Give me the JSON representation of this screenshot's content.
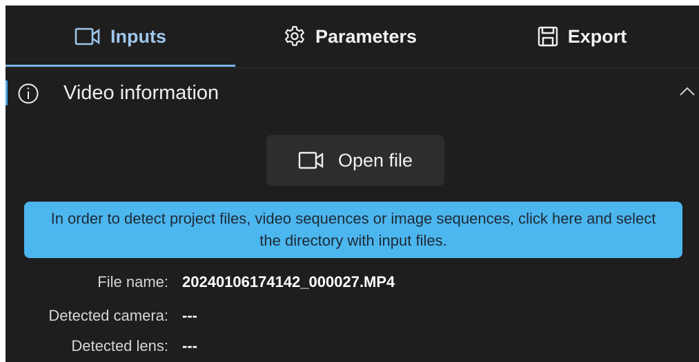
{
  "tabs": [
    {
      "label": "Inputs",
      "icon": "video-camera-icon",
      "active": true
    },
    {
      "label": "Parameters",
      "icon": "gear-icon",
      "active": false
    },
    {
      "label": "Export",
      "icon": "floppy-disk-icon",
      "active": false
    }
  ],
  "section": {
    "title": "Video information",
    "icon": "info-icon",
    "collapse_icon": "chevron-up-icon"
  },
  "open_button": {
    "label": "Open file",
    "icon": "video-camera-icon"
  },
  "banner": {
    "text": "In order to detect project files, video sequences or image sequences, click here and select the directory with input files."
  },
  "details": {
    "file_name_label": "File name:",
    "file_name_value": "20240106174142_000027.MP4",
    "camera_label": "Detected camera:",
    "camera_value": "---",
    "lens_label": "Detected lens:",
    "lens_value": "---"
  },
  "colors": {
    "background": "#1e1e1e",
    "active_tab": "#9fc6ea",
    "accent": "#4aa8ea",
    "banner": "#4cb6ef",
    "button": "#2d2d2d"
  }
}
